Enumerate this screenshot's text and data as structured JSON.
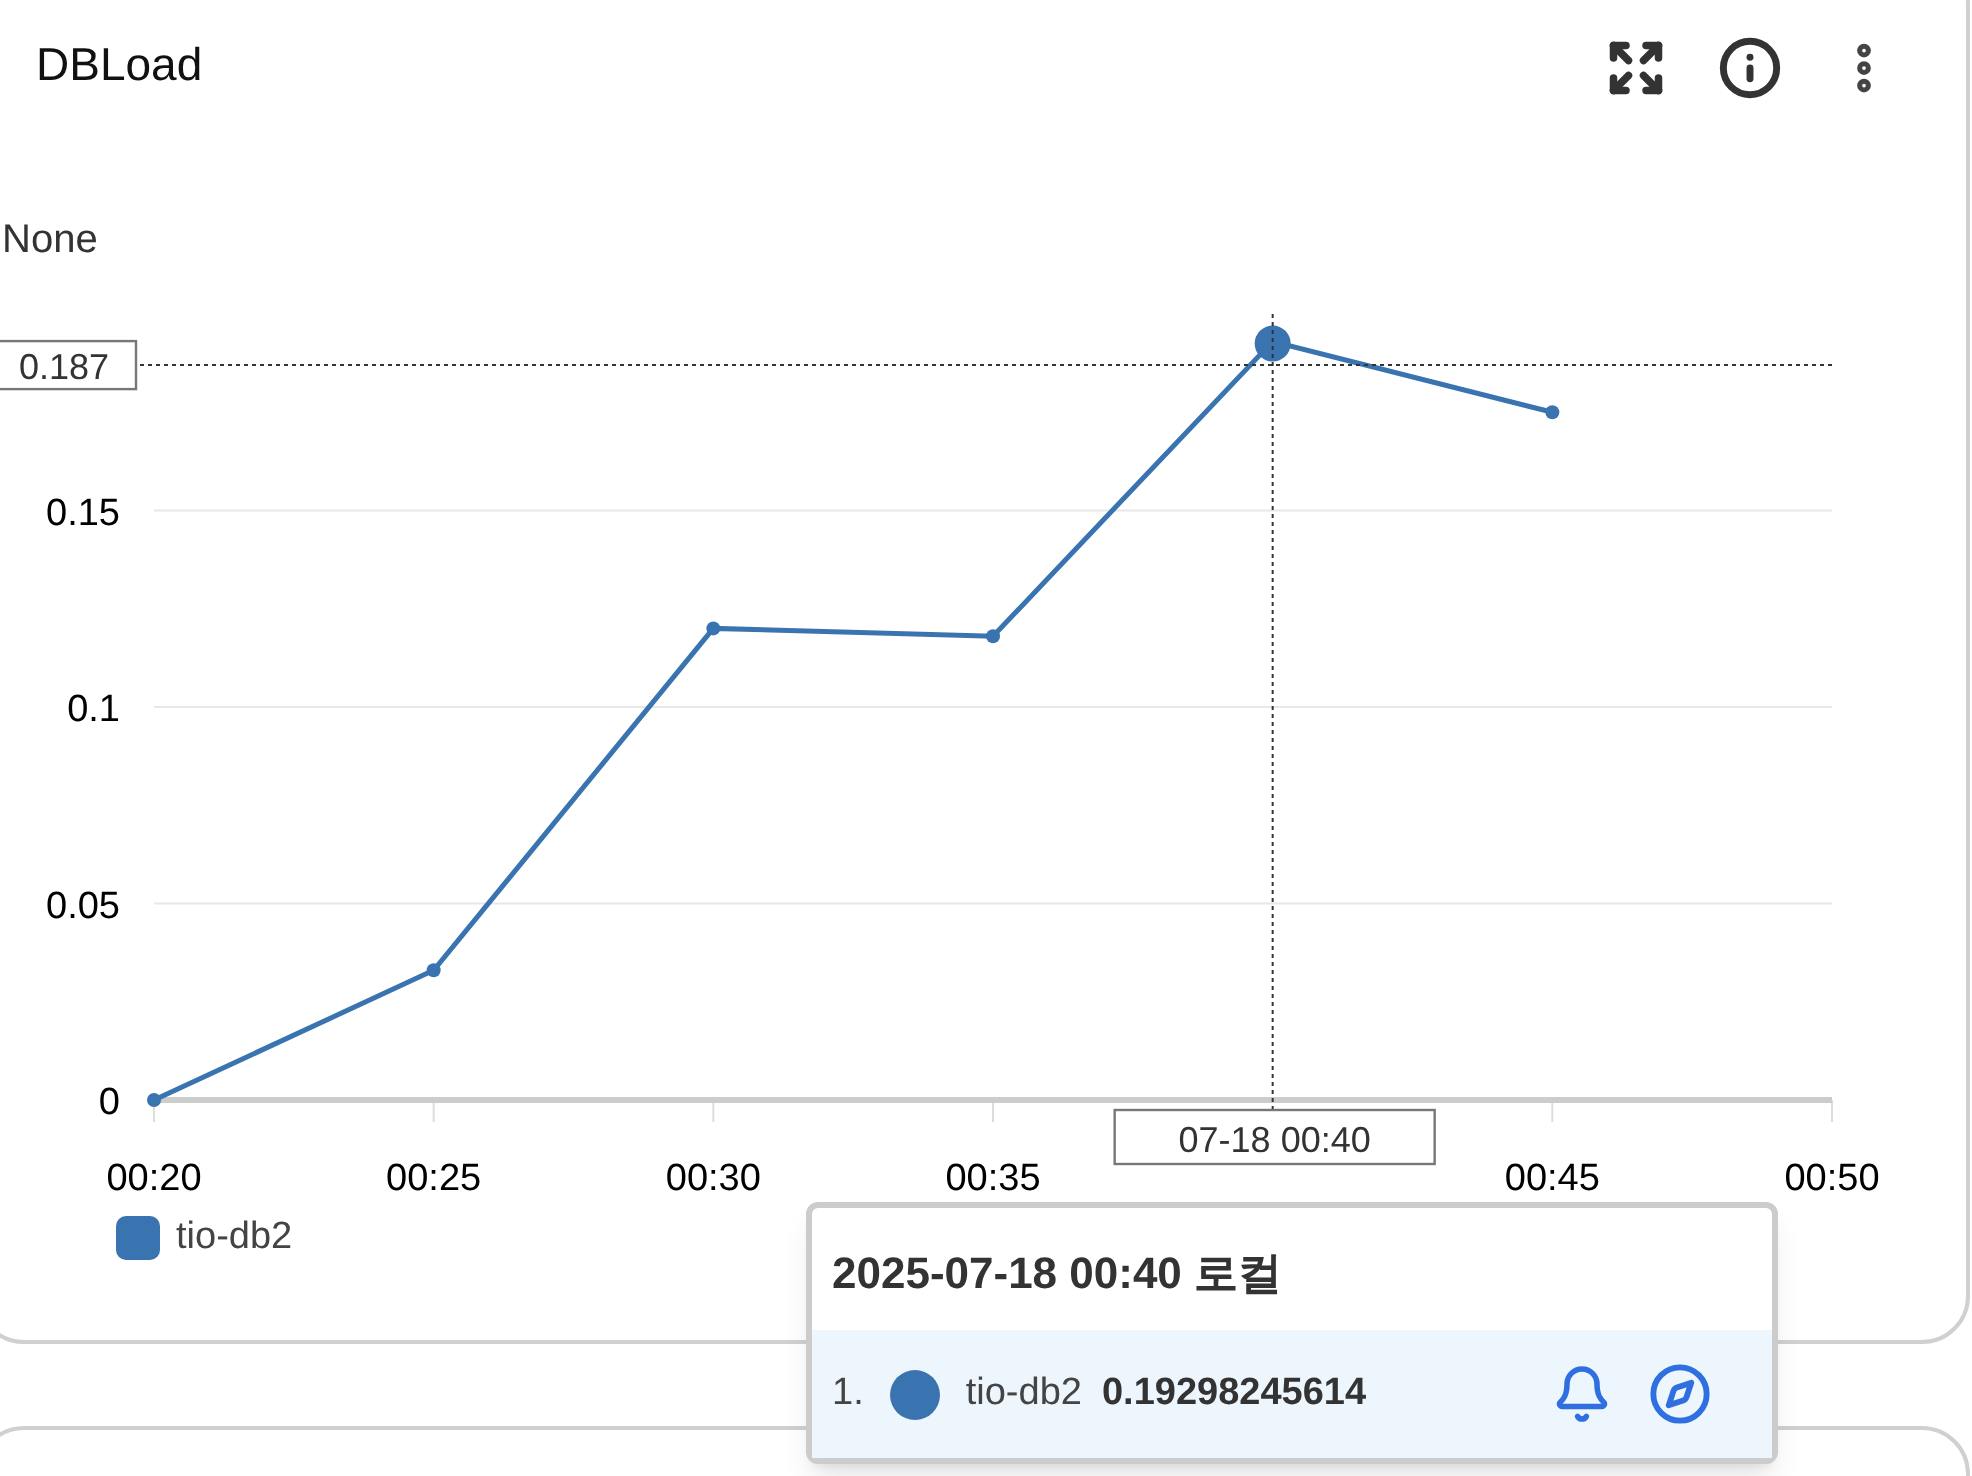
{
  "panel": {
    "title": "DBLoad"
  },
  "chart_data": {
    "type": "line",
    "annotations": [
      {
        "text": "None"
      }
    ],
    "x": [
      20,
      25,
      30,
      35,
      40,
      45
    ],
    "series": [
      {
        "name": "tio-db2",
        "color": "#3a74b0",
        "marker": "circle",
        "values": [
          0,
          0.033,
          0.12,
          0.118,
          0.193,
          0.175
        ]
      }
    ],
    "xlim": [
      20,
      50
    ],
    "xticks": [
      {
        "value": 20,
        "label": "00:20"
      },
      {
        "value": 25,
        "label": "00:25"
      },
      {
        "value": 30,
        "label": "00:30"
      },
      {
        "value": 35,
        "label": "00:35"
      },
      {
        "value": 45,
        "label": "00:45"
      },
      {
        "value": 50,
        "label": "00:50"
      }
    ],
    "yticks": [
      {
        "value": 0,
        "label": "0"
      },
      {
        "value": 0.05,
        "label": "0.05"
      },
      {
        "value": 0.1,
        "label": "0.1"
      },
      {
        "value": 0.15,
        "label": "0.15"
      }
    ],
    "ylim": [
      0,
      0.2
    ],
    "grid": true,
    "ref_lines": [
      {
        "axis": "y",
        "value": 0.187,
        "label": "0.187"
      },
      {
        "axis": "x",
        "value": 40,
        "label": "07-18 00:40"
      }
    ]
  },
  "tooltip": {
    "title": "2025-07-18 00:40 로컬",
    "rows": [
      {
        "index": "1.",
        "name": "tio-db2",
        "value": "0.19298245614",
        "color": "#3a74b0"
      }
    ]
  }
}
